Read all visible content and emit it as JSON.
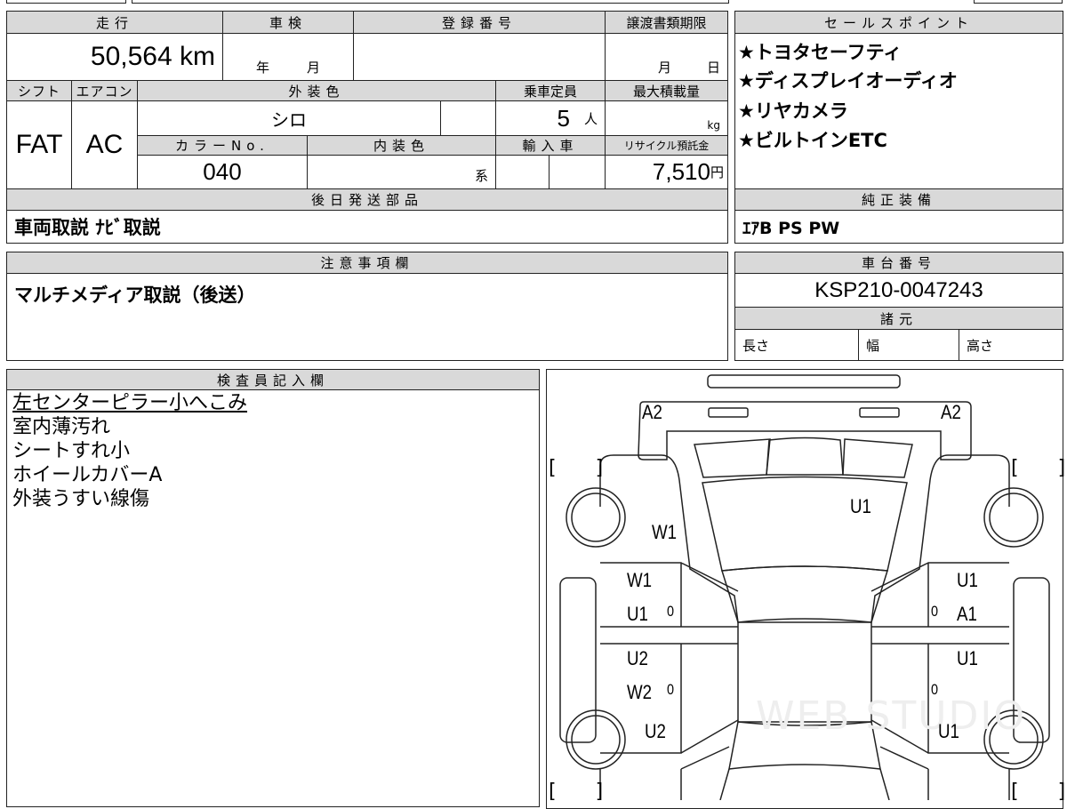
{
  "main_table": {
    "mileage_header": "走行",
    "mileage_value": "50,564 km",
    "inspection_header": "車検",
    "inspection_year_unit": "年",
    "inspection_month_unit": "月",
    "registration_header": "登録番号",
    "transfer_deadline_header": "譲渡書類期限",
    "transfer_month_unit": "月",
    "transfer_day_unit": "日",
    "shift_header": "シフト",
    "shift_value": "FAT",
    "ac_header": "エアコン",
    "ac_value": "AC",
    "exterior_color_header": "外装色",
    "exterior_color_value": "シロ",
    "capacity_header": "乗車定員",
    "capacity_value": "5",
    "capacity_unit": "人",
    "max_load_header": "最大積載量",
    "max_load_unit": "kg",
    "color_no_header": "カラーNo.",
    "color_no_value": "040",
    "interior_color_header": "内装色",
    "interior_color_unit": "系",
    "import_header": "輸入車",
    "recycle_header": "リサイクル預託金",
    "recycle_value": "7,510",
    "recycle_unit": "円",
    "later_parts_header": "後日発送部品",
    "later_parts_value": "車両取説 ﾅﾋﾞ取説"
  },
  "sales_points": {
    "header": "セールスポイント",
    "items": [
      "★トヨタセーフティ",
      "★ディスプレイオーディオ",
      "★リヤカメラ",
      "★ビルトインETC"
    ]
  },
  "genuine_equipment": {
    "header": "純正装備",
    "value": "ｴｱB PS PW"
  },
  "notes": {
    "header": "注意事項欄",
    "value": "マルチメディア取説（後送）"
  },
  "chassis": {
    "header": "車台番号",
    "value": "KSP210-0047243",
    "specs_header": "諸元",
    "length_label": "長さ",
    "width_label": "幅",
    "height_label": "高さ"
  },
  "inspector": {
    "header": "検査員記入欄",
    "lines": [
      "左センターピラー小へこみ",
      "室内薄汚れ",
      "シートすれ小",
      "ホイールカバーA",
      "外装うすい線傷"
    ]
  },
  "diagram": {
    "marks": {
      "front_left_bumper": "A2",
      "front_right_bumper": "A2",
      "hood": "U1",
      "left_front_fender": "W1",
      "left_front_door_1": "W1",
      "left_front_door_2": "U1",
      "left_front_door_0": "0",
      "right_front_door_1": "U1",
      "right_front_door_2": "A1",
      "right_front_door_0": "0",
      "left_rear_door_1": "U2",
      "left_rear_door_2": "W2",
      "left_rear_door_0": "0",
      "right_rear_door_1": "U1",
      "right_rear_door_0": "0",
      "left_rear_fender": "U2",
      "right_rear_fender": "U1"
    },
    "bracket": "[　　]",
    "watermark": "WEB STUDIO"
  }
}
